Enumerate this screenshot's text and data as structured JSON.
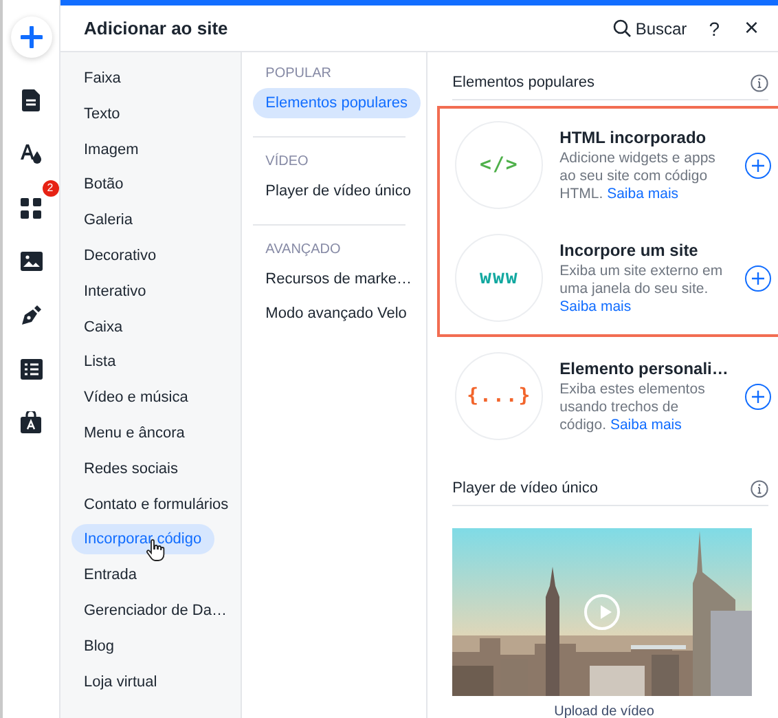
{
  "rail": {
    "items": [
      {
        "kind": "add"
      },
      {
        "kind": "page"
      },
      {
        "kind": "design"
      },
      {
        "kind": "apps",
        "badge": "2"
      },
      {
        "kind": "media"
      },
      {
        "kind": "pen"
      },
      {
        "kind": "table"
      },
      {
        "kind": "store"
      }
    ]
  },
  "panel": {
    "title": "Adicionar ao site",
    "search": "Buscar",
    "help": "?",
    "close": "×"
  },
  "categories": [
    {
      "label": "Faixa",
      "selected": false
    },
    {
      "label": "Texto",
      "selected": false
    },
    {
      "label": "Imagem",
      "selected": false
    },
    {
      "label": "Botão",
      "selected": false
    },
    {
      "label": "Galeria",
      "selected": false
    },
    {
      "label": "Decorativo",
      "selected": false
    },
    {
      "label": "Interativo",
      "selected": false
    },
    {
      "label": "Caixa",
      "selected": false
    },
    {
      "label": "Lista",
      "selected": false
    },
    {
      "label": "Vídeo e música",
      "selected": false
    },
    {
      "label": "Menu e âncora",
      "selected": false
    },
    {
      "label": "Redes sociais",
      "selected": false
    },
    {
      "label": "Contato e formulários",
      "selected": false
    },
    {
      "label": "Incorporar código",
      "selected": true
    },
    {
      "label": "Entrada",
      "selected": false
    },
    {
      "label": "Gerenciador de Da…",
      "selected": false
    },
    {
      "label": "Blog",
      "selected": false
    },
    {
      "label": "Loja virtual",
      "selected": false
    }
  ],
  "subcategories": [
    {
      "heading": "POPULAR",
      "items": [
        {
          "label": "Elementos populares",
          "selected": true
        }
      ]
    },
    {
      "heading": "VÍDEO",
      "items": [
        {
          "label": "Player de vídeo único",
          "selected": false
        }
      ]
    },
    {
      "heading": "AVANÇADO",
      "items": [
        {
          "label": "Recursos de marke…",
          "selected": false
        },
        {
          "label": "Modo avançado Velo",
          "selected": false
        }
      ]
    }
  ],
  "sections": [
    {
      "title": "Elementos populares",
      "kind": "elements",
      "elements": [
        {
          "icon_text": "</>",
          "color": "#4eb04a",
          "title": "HTML incorporado",
          "description": "Adicione widgets e apps ao seu site com código HTML.",
          "link": "Saiba mais",
          "highlighted": true
        },
        {
          "icon_text": "www",
          "color": "#12a8a0",
          "title": "Incorpore um site",
          "description": "Exiba um site externo em uma janela do seu site.",
          "link": "Saiba mais",
          "highlighted": true
        },
        {
          "icon_text": "{...}",
          "color": "#f2652c",
          "title": "Elemento personali…",
          "description": "Exiba estes elementos usando trechos de código.",
          "link": "Saiba mais",
          "highlighted": false
        }
      ]
    },
    {
      "title": "Player de vídeo único",
      "kind": "video",
      "caption": "Upload de vídeo"
    }
  ]
}
